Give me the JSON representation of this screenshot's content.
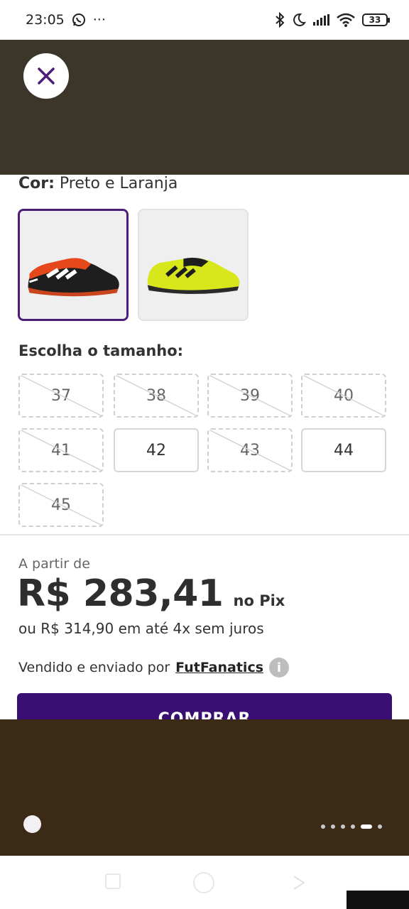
{
  "status_bar": {
    "time": "23:05",
    "more": "···",
    "battery": "33"
  },
  "color": {
    "label": "Cor:",
    "value": "Preto e Laranja"
  },
  "sizes": {
    "title": "Escolha o tamanho:",
    "items": [
      {
        "label": "37",
        "available": false
      },
      {
        "label": "38",
        "available": false
      },
      {
        "label": "39",
        "available": false
      },
      {
        "label": "40",
        "available": false
      },
      {
        "label": "41",
        "available": false
      },
      {
        "label": "42",
        "available": true
      },
      {
        "label": "43",
        "available": false
      },
      {
        "label": "44",
        "available": true
      },
      {
        "label": "45",
        "available": false
      }
    ]
  },
  "pricing": {
    "from_label": "A partir de",
    "price": "R$ 283,41",
    "pix_label": "no Pix",
    "installments": "ou R$ 314,90 em até 4x sem juros",
    "seller_prefix": "Vendido e enviado por",
    "seller_name": "FutFanatics",
    "info_icon": "i"
  },
  "buy_button": {
    "label": "COMPRAR"
  },
  "colors": {
    "accent": "#3a0e73",
    "top_overlay": "#3c3529",
    "bottom_overlay": "#3b2a16"
  }
}
